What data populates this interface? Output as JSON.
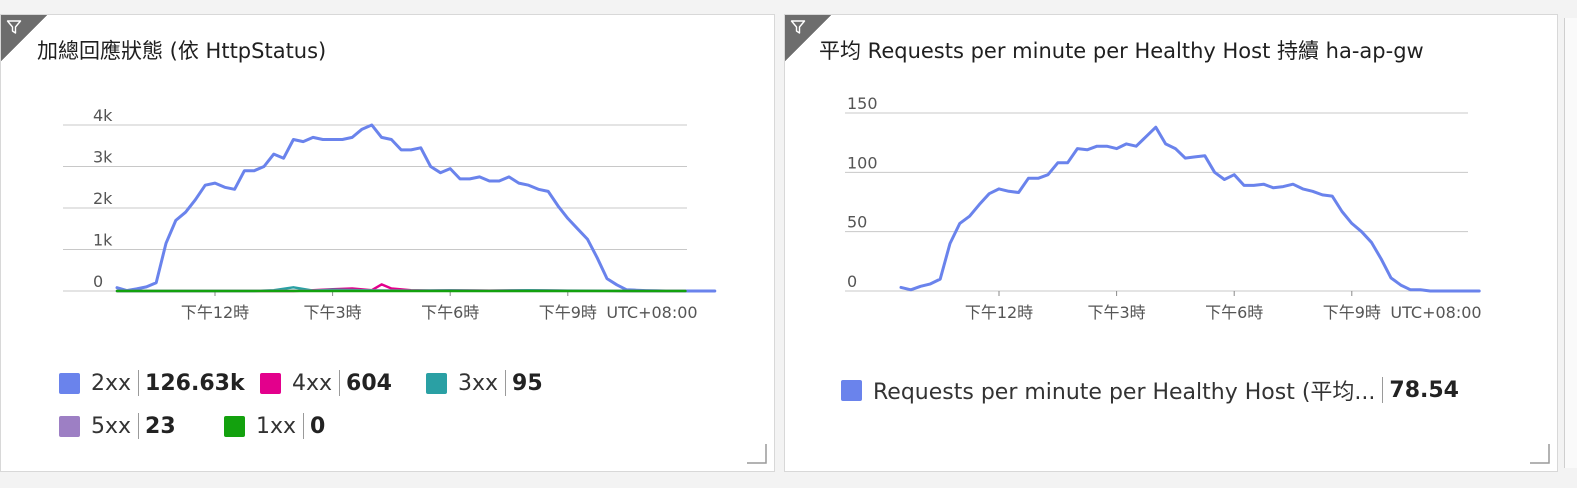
{
  "tiles": [
    {
      "title": "加總回應狀態 (依 HttpStatus)",
      "legend": [
        {
          "name": "2xx",
          "value": "126.63k",
          "color": "#6a83ec"
        },
        {
          "name": "4xx",
          "value": "604",
          "color": "#e3008c"
        },
        {
          "name": "3xx",
          "value": "95",
          "color": "#2aa0a4"
        },
        {
          "name": "5xx",
          "value": "23",
          "color": "#9d7fc4"
        },
        {
          "name": "1xx",
          "value": "0",
          "color": "#13a10e"
        }
      ]
    },
    {
      "title": "平均 Requests per minute per Healthy Host 持續 ha-ap-gw",
      "legend": [
        {
          "name": "Requests per minute per Healthy Host (平均...",
          "value": "78.54",
          "color": "#6a83ec"
        }
      ]
    }
  ],
  "chart_data": [
    {
      "type": "line",
      "ylim": [
        0,
        4000
      ],
      "y_ticks": [
        0,
        1000,
        2000,
        3000,
        4000
      ],
      "y_tick_labels": [
        "0",
        "1k",
        "2k",
        "3k",
        "4k"
      ],
      "grid": true,
      "x_range_hours": [
        9.5,
        17.2
      ],
      "x_ticks": [
        12,
        15,
        18,
        21
      ],
      "x_tick_labels": [
        "下午12時",
        "下午3時",
        "下午6時",
        "下午9時"
      ],
      "x_unit_label": "UTC+08:00",
      "series": [
        {
          "name": "2xx",
          "color": "#6a83ec",
          "x": [
            9.5,
            9.75,
            10,
            10.25,
            10.5,
            10.75,
            11,
            11.25,
            11.5,
            11.75,
            12,
            12.25,
            12.5,
            12.75,
            13,
            13.25,
            13.5,
            13.75,
            14,
            14.25,
            14.5,
            14.75,
            15,
            15.25,
            15.5,
            15.75,
            16,
            16.25,
            16.5,
            16.75,
            17,
            17.25,
            17.5,
            17.75,
            18,
            18.25,
            18.5,
            18.75,
            19,
            19.25,
            19.5,
            19.75,
            20,
            20.25,
            20.5,
            20.75,
            21,
            21.25,
            21.5,
            21.75,
            22,
            22.25,
            22.5,
            22.75,
            23,
            23.25,
            23.5,
            23.75,
            24,
            24.25,
            24.5,
            24.75
          ],
          "values": [
            80,
            10,
            50,
            100,
            200,
            1150,
            1700,
            1900,
            2200,
            2550,
            2600,
            2500,
            2450,
            2900,
            2900,
            3000,
            3300,
            3200,
            3650,
            3600,
            3700,
            3650,
            3650,
            3650,
            3700,
            3900,
            4000,
            3700,
            3650,
            3400,
            3400,
            3450,
            3000,
            2850,
            2950,
            2700,
            2700,
            2750,
            2650,
            2650,
            2750,
            2600,
            2550,
            2450,
            2400,
            2050,
            1750,
            1500,
            1250,
            800,
            300,
            150,
            30,
            20,
            10,
            5,
            0,
            0,
            0,
            0,
            0,
            0
          ]
        },
        {
          "name": "4xx",
          "color": "#e3008c",
          "x": [
            9.5,
            12,
            14,
            14.5,
            15,
            15.5,
            16,
            16.25,
            16.5,
            17,
            17.5,
            18,
            19,
            20,
            21,
            22,
            23,
            24
          ],
          "values": [
            0,
            0,
            0,
            20,
            40,
            60,
            20,
            160,
            60,
            20,
            10,
            15,
            10,
            15,
            5,
            5,
            0,
            0
          ]
        },
        {
          "name": "3xx",
          "color": "#2aa0a4",
          "x": [
            9.5,
            10,
            12,
            13,
            13.5,
            14,
            14.5,
            15,
            16,
            17,
            18,
            19,
            20,
            21,
            22,
            23,
            24
          ],
          "values": [
            0,
            0,
            0,
            0,
            20,
            90,
            10,
            30,
            15,
            10,
            15,
            5,
            20,
            10,
            5,
            0,
            0
          ]
        },
        {
          "name": "5xx",
          "color": "#9d7fc4",
          "x": [
            9.5,
            13,
            15,
            18,
            21,
            24
          ],
          "values": [
            0,
            5,
            10,
            5,
            3,
            0
          ]
        },
        {
          "name": "1xx",
          "color": "#13a10e",
          "x": [
            9.5,
            12,
            15,
            18,
            21,
            24
          ],
          "values": [
            0,
            0,
            0,
            0,
            0,
            0
          ]
        }
      ]
    },
    {
      "type": "line",
      "ylim": [
        0,
        150
      ],
      "y_ticks": [
        0,
        50,
        100,
        150
      ],
      "y_tick_labels": [
        "0",
        "50",
        "100",
        "150"
      ],
      "grid": true,
      "x_ticks": [
        12,
        15,
        18,
        21
      ],
      "x_tick_labels": [
        "下午12時",
        "下午3時",
        "下午6時",
        "下午9時"
      ],
      "x_unit_label": "UTC+08:00",
      "series": [
        {
          "name": "Requests per minute per Healthy Host (平均...",
          "color": "#6a83ec",
          "x": [
            9.5,
            9.75,
            10,
            10.25,
            10.5,
            10.75,
            11,
            11.25,
            11.5,
            11.75,
            12,
            12.25,
            12.5,
            12.75,
            13,
            13.25,
            13.5,
            13.75,
            14,
            14.25,
            14.5,
            14.75,
            15,
            15.25,
            15.5,
            15.75,
            16,
            16.25,
            16.5,
            16.75,
            17,
            17.25,
            17.5,
            17.75,
            18,
            18.25,
            18.5,
            18.75,
            19,
            19.25,
            19.5,
            19.75,
            20,
            20.25,
            20.5,
            20.75,
            21,
            21.25,
            21.5,
            21.75,
            22,
            22.25,
            22.5,
            22.75,
            23,
            23.25,
            23.5,
            23.75,
            24,
            24.25
          ],
          "values": [
            3,
            1,
            4,
            6,
            10,
            40,
            57,
            63,
            73,
            82,
            86,
            84,
            83,
            95,
            95,
            98,
            108,
            108,
            120,
            119,
            122,
            122,
            120,
            124,
            122,
            130,
            138,
            124,
            120,
            112,
            113,
            114,
            100,
            94,
            98,
            89,
            89,
            90,
            87,
            88,
            90,
            86,
            84,
            81,
            80,
            67,
            57,
            50,
            41,
            27,
            11,
            5,
            1,
            1,
            0,
            0,
            0,
            0,
            0,
            0
          ]
        }
      ]
    }
  ]
}
